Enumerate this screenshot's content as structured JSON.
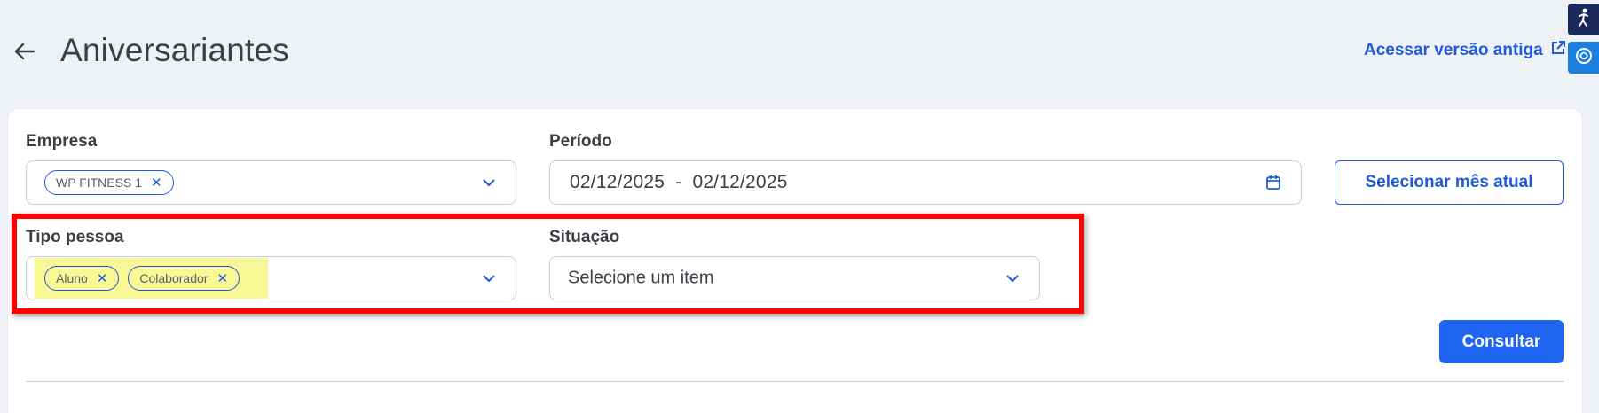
{
  "header": {
    "title": "Aniversariantes",
    "old_version_link": "Acessar versão antiga"
  },
  "filters": {
    "empresa": {
      "label": "Empresa",
      "chips": [
        "WP FITNESS 1"
      ]
    },
    "periodo": {
      "label": "Período",
      "start": "02/12/2025",
      "separator": "-",
      "end": "02/12/2025"
    },
    "select_month_button": "Selecionar mês atual",
    "tipo_pessoa": {
      "label": "Tipo pessoa",
      "chips": [
        "Aluno",
        "Colaborador"
      ]
    },
    "situacao": {
      "label": "Situação",
      "placeholder": "Selecione um item"
    }
  },
  "actions": {
    "consultar": "Consultar"
  },
  "colors": {
    "accent": "#1e5bdc",
    "primary_button": "#1e64f0",
    "highlight_border": "#ff0000",
    "highlight_fill": "#f7f78a"
  }
}
